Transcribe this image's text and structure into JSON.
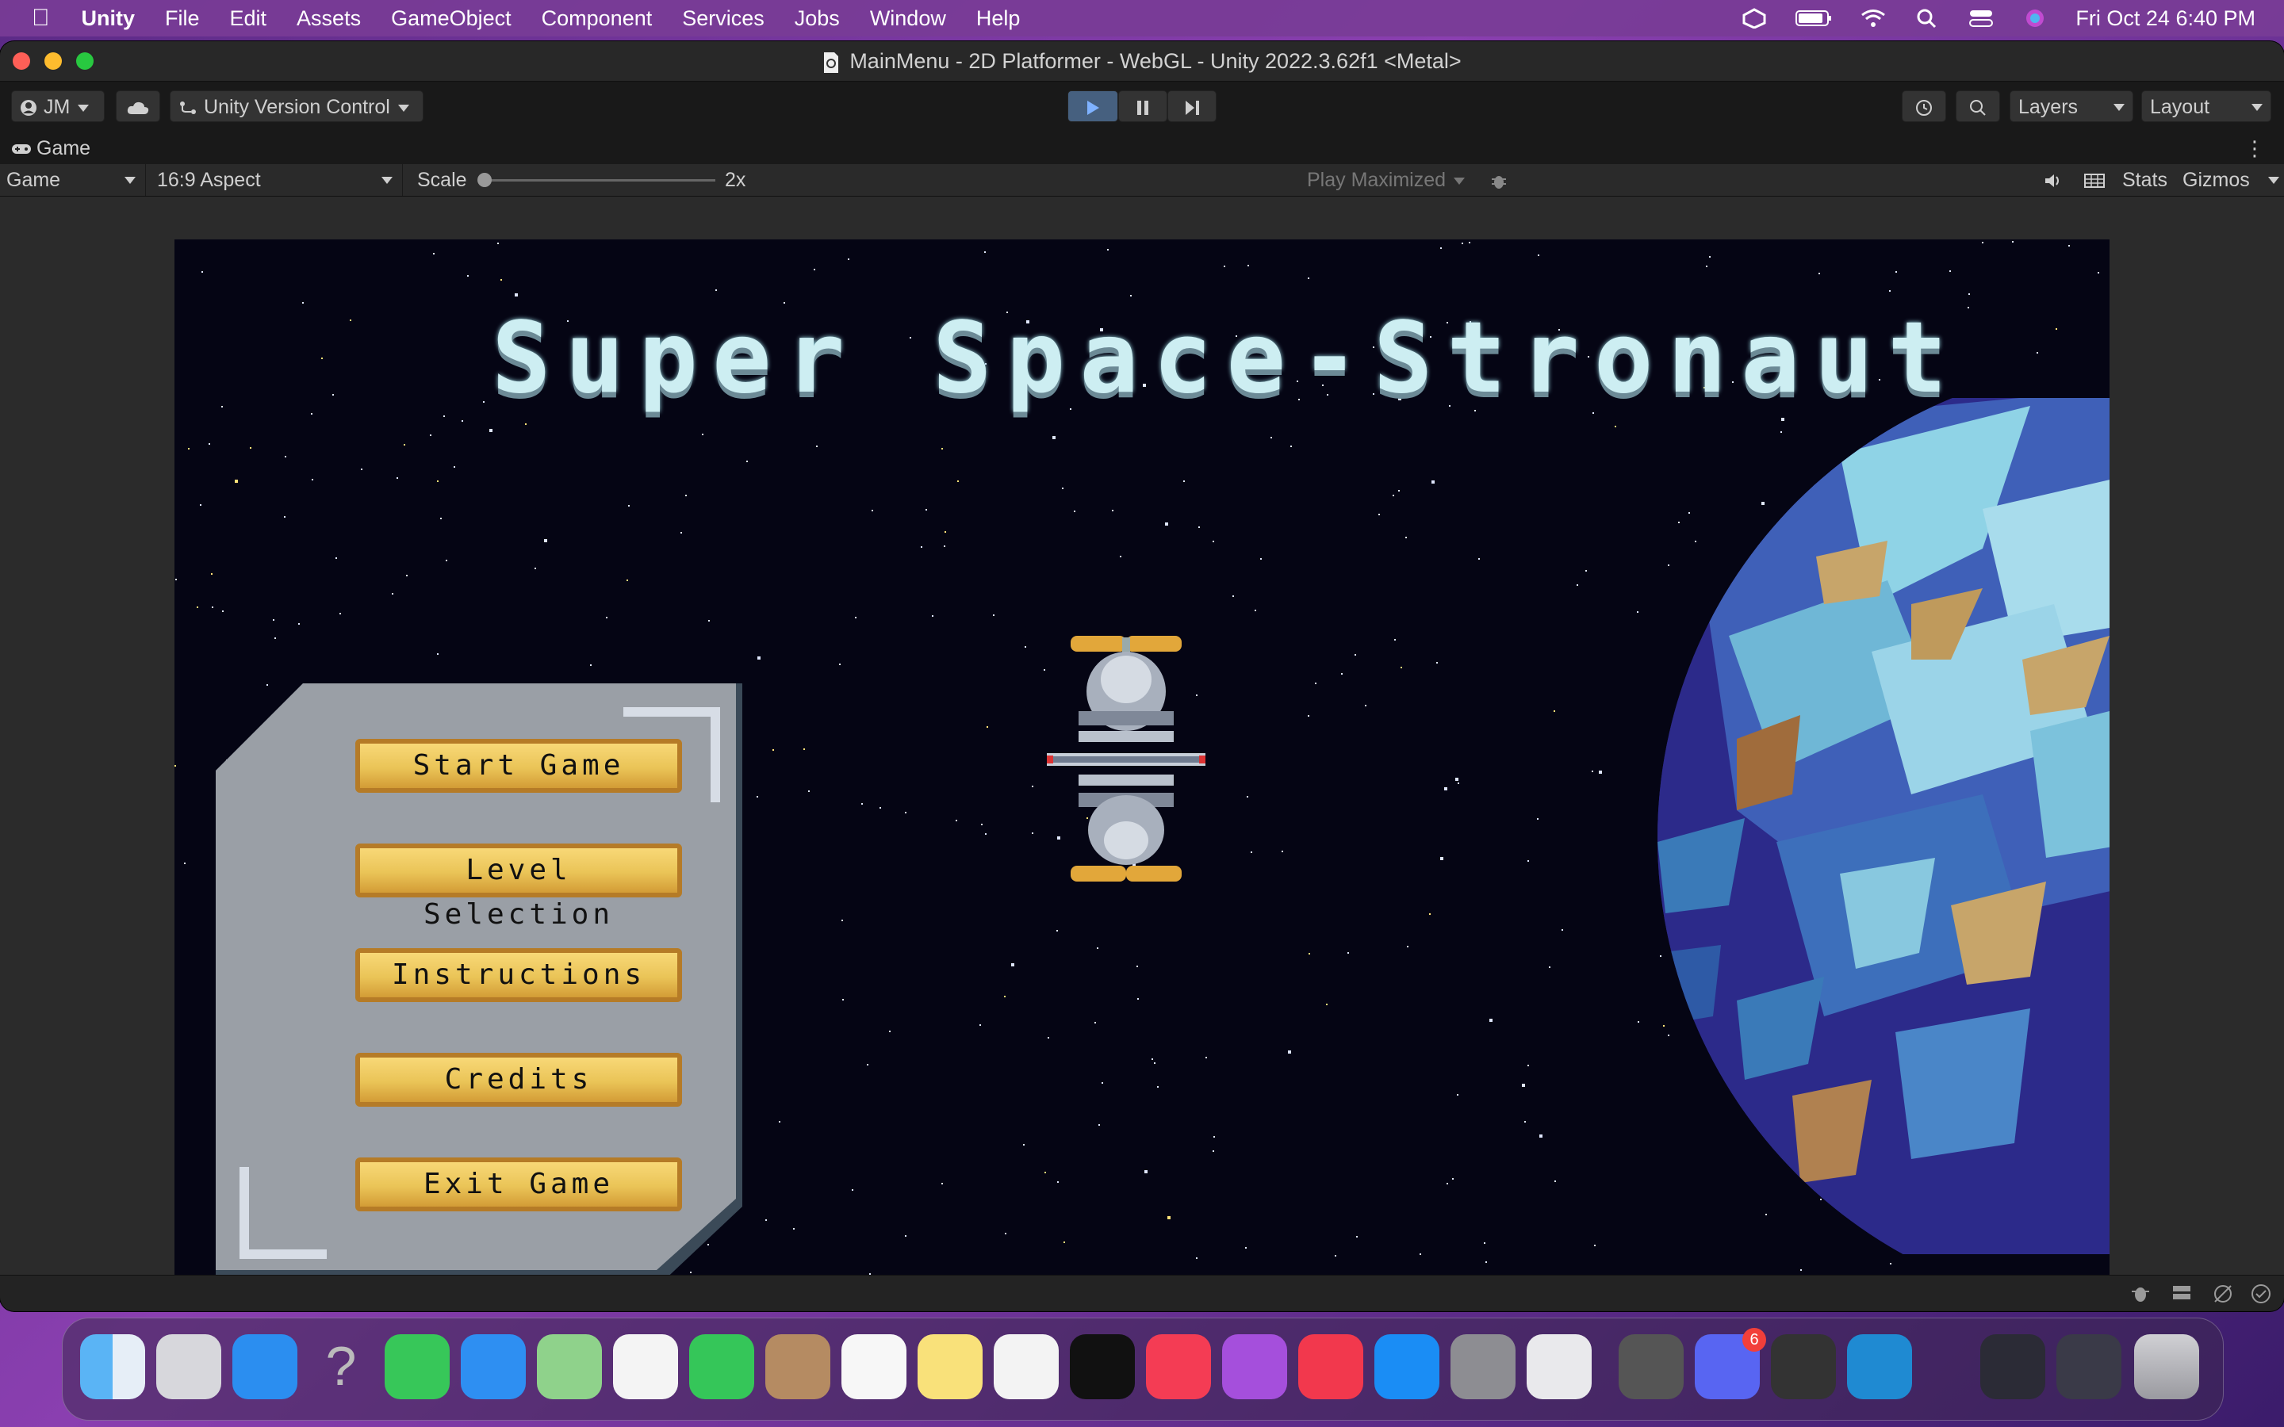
{
  "menubar": {
    "app_name": "Unity",
    "items": [
      "File",
      "Edit",
      "Assets",
      "GameObject",
      "Component",
      "Services",
      "Jobs",
      "Window",
      "Help"
    ],
    "clock": "Fri Oct 24  6:40 PM",
    "status_icons": [
      "unity-hub-icon",
      "battery-icon",
      "wifi-icon",
      "search-icon",
      "control-center-icon",
      "siri-icon"
    ]
  },
  "window": {
    "title": "MainMenu - 2D Platformer - WebGL - Unity 2022.3.62f1 <Metal>"
  },
  "toolbar": {
    "account": "JM",
    "version_control": "Unity Version Control",
    "layers": "Layers",
    "layout": "Layout"
  },
  "game_view": {
    "tab_label": "Game",
    "display_dropdown": "Game",
    "aspect_dropdown": "16:9 Aspect",
    "scale_label": "Scale",
    "scale_value": "2x",
    "scale_slider_fraction": 0.0,
    "play_mode": "Play Maximized",
    "stats_label": "Stats",
    "gizmos_label": "Gizmos"
  },
  "game": {
    "title": "Super Space-Stronaut",
    "menu_buttons": [
      "Start Game",
      "Level Selection",
      "Instructions",
      "Credits",
      "Exit Game"
    ]
  },
  "dock": {
    "apps": [
      "finder",
      "launchpad",
      "safari",
      "help",
      "messages",
      "mail",
      "maps",
      "photos",
      "facetime",
      "contacts",
      "reminders",
      "notes",
      "freeform",
      "apple-tv",
      "music",
      "podcasts",
      "news",
      "app-store",
      "system-settings",
      "roblox",
      "unity-hub",
      "discord",
      "unity",
      "vscode",
      "downloads",
      "trash"
    ],
    "discord_badge": "6"
  },
  "colors": {
    "accent_play": "#3d7ad6",
    "title_text": "#cdeef2",
    "button_gold": "#eac457",
    "panel_gray": "#9a9fa6"
  }
}
